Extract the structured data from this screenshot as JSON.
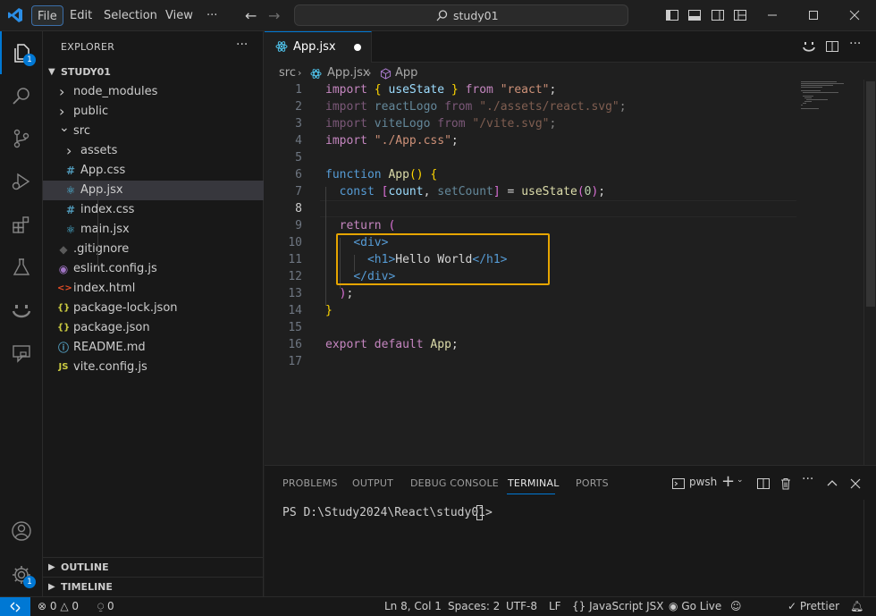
{
  "titlebar": {
    "menus": [
      "File",
      "Edit",
      "Selection",
      "View"
    ],
    "more": "···",
    "search_text": "study01"
  },
  "activity": {
    "explorer_badge": "1",
    "manage_badge": "1"
  },
  "sidebar": {
    "title": "EXPLORER",
    "more": "···",
    "root": "STUDY01",
    "items": [
      {
        "name": "node_modules",
        "icon": "chevron-right"
      },
      {
        "name": "public",
        "icon": "chevron-right"
      },
      {
        "name": "src",
        "icon": "chevron-down"
      },
      {
        "name": "assets",
        "icon": "chevron-right"
      },
      {
        "name": "App.css",
        "icon": "#"
      },
      {
        "name": "App.jsx",
        "icon": "react"
      },
      {
        "name": "index.css",
        "icon": "#"
      },
      {
        "name": "main.jsx",
        "icon": "react"
      },
      {
        "name": ".gitignore",
        "icon": "git"
      },
      {
        "name": "eslint.config.js",
        "icon": "eslint"
      },
      {
        "name": "index.html",
        "icon": "<>"
      },
      {
        "name": "package-lock.json",
        "icon": "{}"
      },
      {
        "name": "package.json",
        "icon": "{}"
      },
      {
        "name": "README.md",
        "icon": "ⓘ"
      },
      {
        "name": "vite.config.js",
        "icon": "JS"
      }
    ],
    "outline": "OUTLINE",
    "timeline": "TIMELINE"
  },
  "editor": {
    "tab_name": "App.jsx",
    "breadcrumb": [
      "src",
      "App.jsx",
      "App"
    ],
    "line_numbers": [
      "1",
      "2",
      "3",
      "4",
      "5",
      "6",
      "7",
      "8",
      "9",
      "10",
      "11",
      "12",
      "13",
      "14",
      "15",
      "16",
      "17"
    ]
  },
  "panel": {
    "tabs": [
      "PROBLEMS",
      "OUTPUT",
      "DEBUG CONSOLE",
      "TERMINAL",
      "PORTS"
    ],
    "shell": "pwsh",
    "prompt": "PS D:\\Study2024\\React\\study01> "
  },
  "statusbar": {
    "errors": "0",
    "warnings": "0",
    "ports": "0",
    "position": "Ln 8, Col 1",
    "spaces": "Spaces: 2",
    "encoding": "UTF-8",
    "eol": "LF",
    "language": "JavaScript JSX",
    "golive": "Go Live",
    "prettier": "Prettier"
  },
  "colors": {
    "accent": "#0078d4",
    "highlight_box": "#e6a500"
  }
}
